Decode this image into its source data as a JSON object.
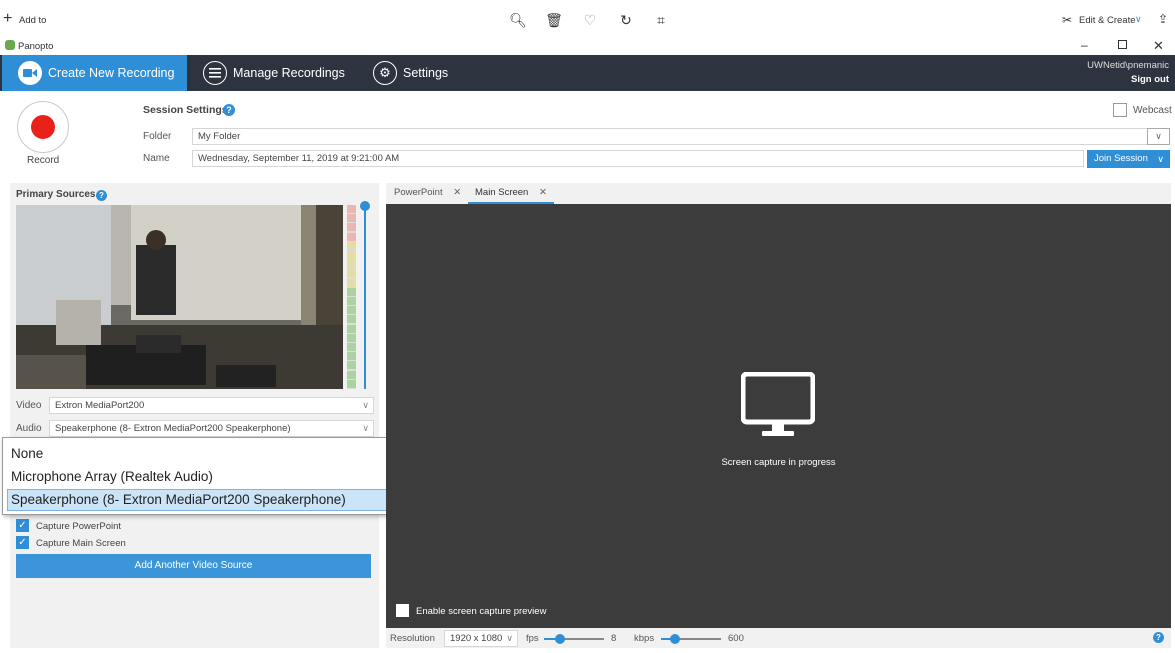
{
  "viewer": {
    "add_to": "Add to",
    "edit_create": "Edit & Create"
  },
  "window": {
    "app_name": "Panopto"
  },
  "nav": {
    "create": "Create New Recording",
    "manage": "Manage Recordings",
    "settings": "Settings",
    "user": "UWNetid\\pnemanic",
    "sign_out": "Sign out"
  },
  "session": {
    "record_label": "Record",
    "settings_title": "Session Settings",
    "folder_label": "Folder",
    "folder_value": "My Folder",
    "name_label": "Name",
    "name_value": "Wednesday, September 11, 2019 at 9:21:00 AM",
    "webcast_label": "Webcast",
    "join_session": "Join Session"
  },
  "sources": {
    "title": "Primary Sources",
    "video_label": "Video",
    "video_value": "Extron MediaPort200",
    "audio_label": "Audio",
    "audio_value": "Speakerphone (8- Extron MediaPort200 Speakerphone)",
    "audio_options": [
      "None",
      "Microphone Array (Realtek Audio)",
      "Speakerphone (8- Extron MediaPort200 Speakerphone)"
    ],
    "audio_selected_index": 2,
    "capture_powerpoint": "Capture PowerPoint",
    "capture_main_screen": "Capture Main Screen",
    "add_source": "Add Another Video Source"
  },
  "preview": {
    "tabs": [
      "PowerPoint",
      "Main Screen"
    ],
    "active_tab": 1,
    "status": "Screen capture in progress",
    "enable_preview": "Enable screen capture preview",
    "resolution_label": "Resolution",
    "resolution_value": "1920 x 1080",
    "fps_label": "fps",
    "fps_value": "8",
    "kbps_label": "kbps",
    "kbps_value": "600"
  },
  "colors": {
    "accent": "#2f8fd6",
    "nav_bg": "#2d3440",
    "preview_bg": "#3c3c3c",
    "record_red": "#e8221b"
  }
}
